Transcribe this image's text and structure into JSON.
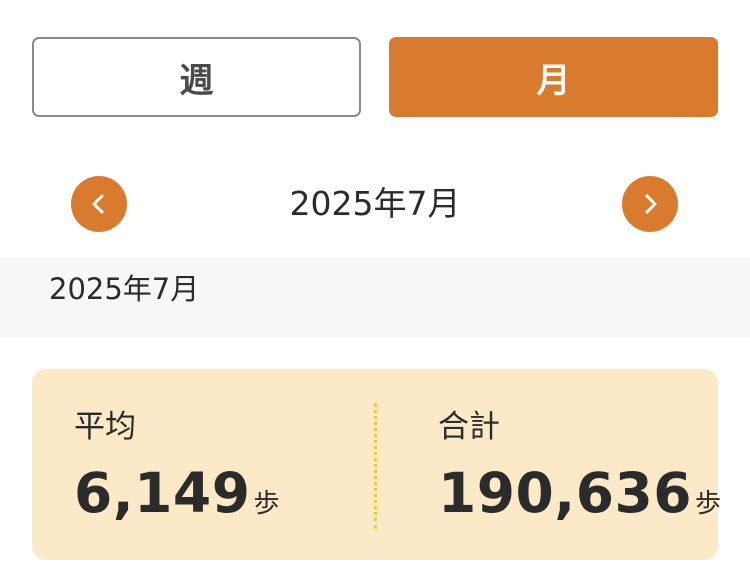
{
  "period_toggle": {
    "week_label": "週",
    "month_label": "月",
    "selected": "月"
  },
  "month_nav": {
    "title": "2025年7月",
    "prev_icon": "chevron-left-icon",
    "next_icon": "chevron-right-icon"
  },
  "section_header": {
    "label": "2025年7月"
  },
  "summary": {
    "average": {
      "label": "平均",
      "value": "6,149",
      "unit": "歩"
    },
    "total": {
      "label": "合計",
      "value": "190,636",
      "unit": "歩"
    }
  },
  "colors": {
    "accent": "#d87b2e",
    "card_background": "#fbe9c7",
    "divider": "#eac84a",
    "header_background": "#f7f7f7"
  }
}
